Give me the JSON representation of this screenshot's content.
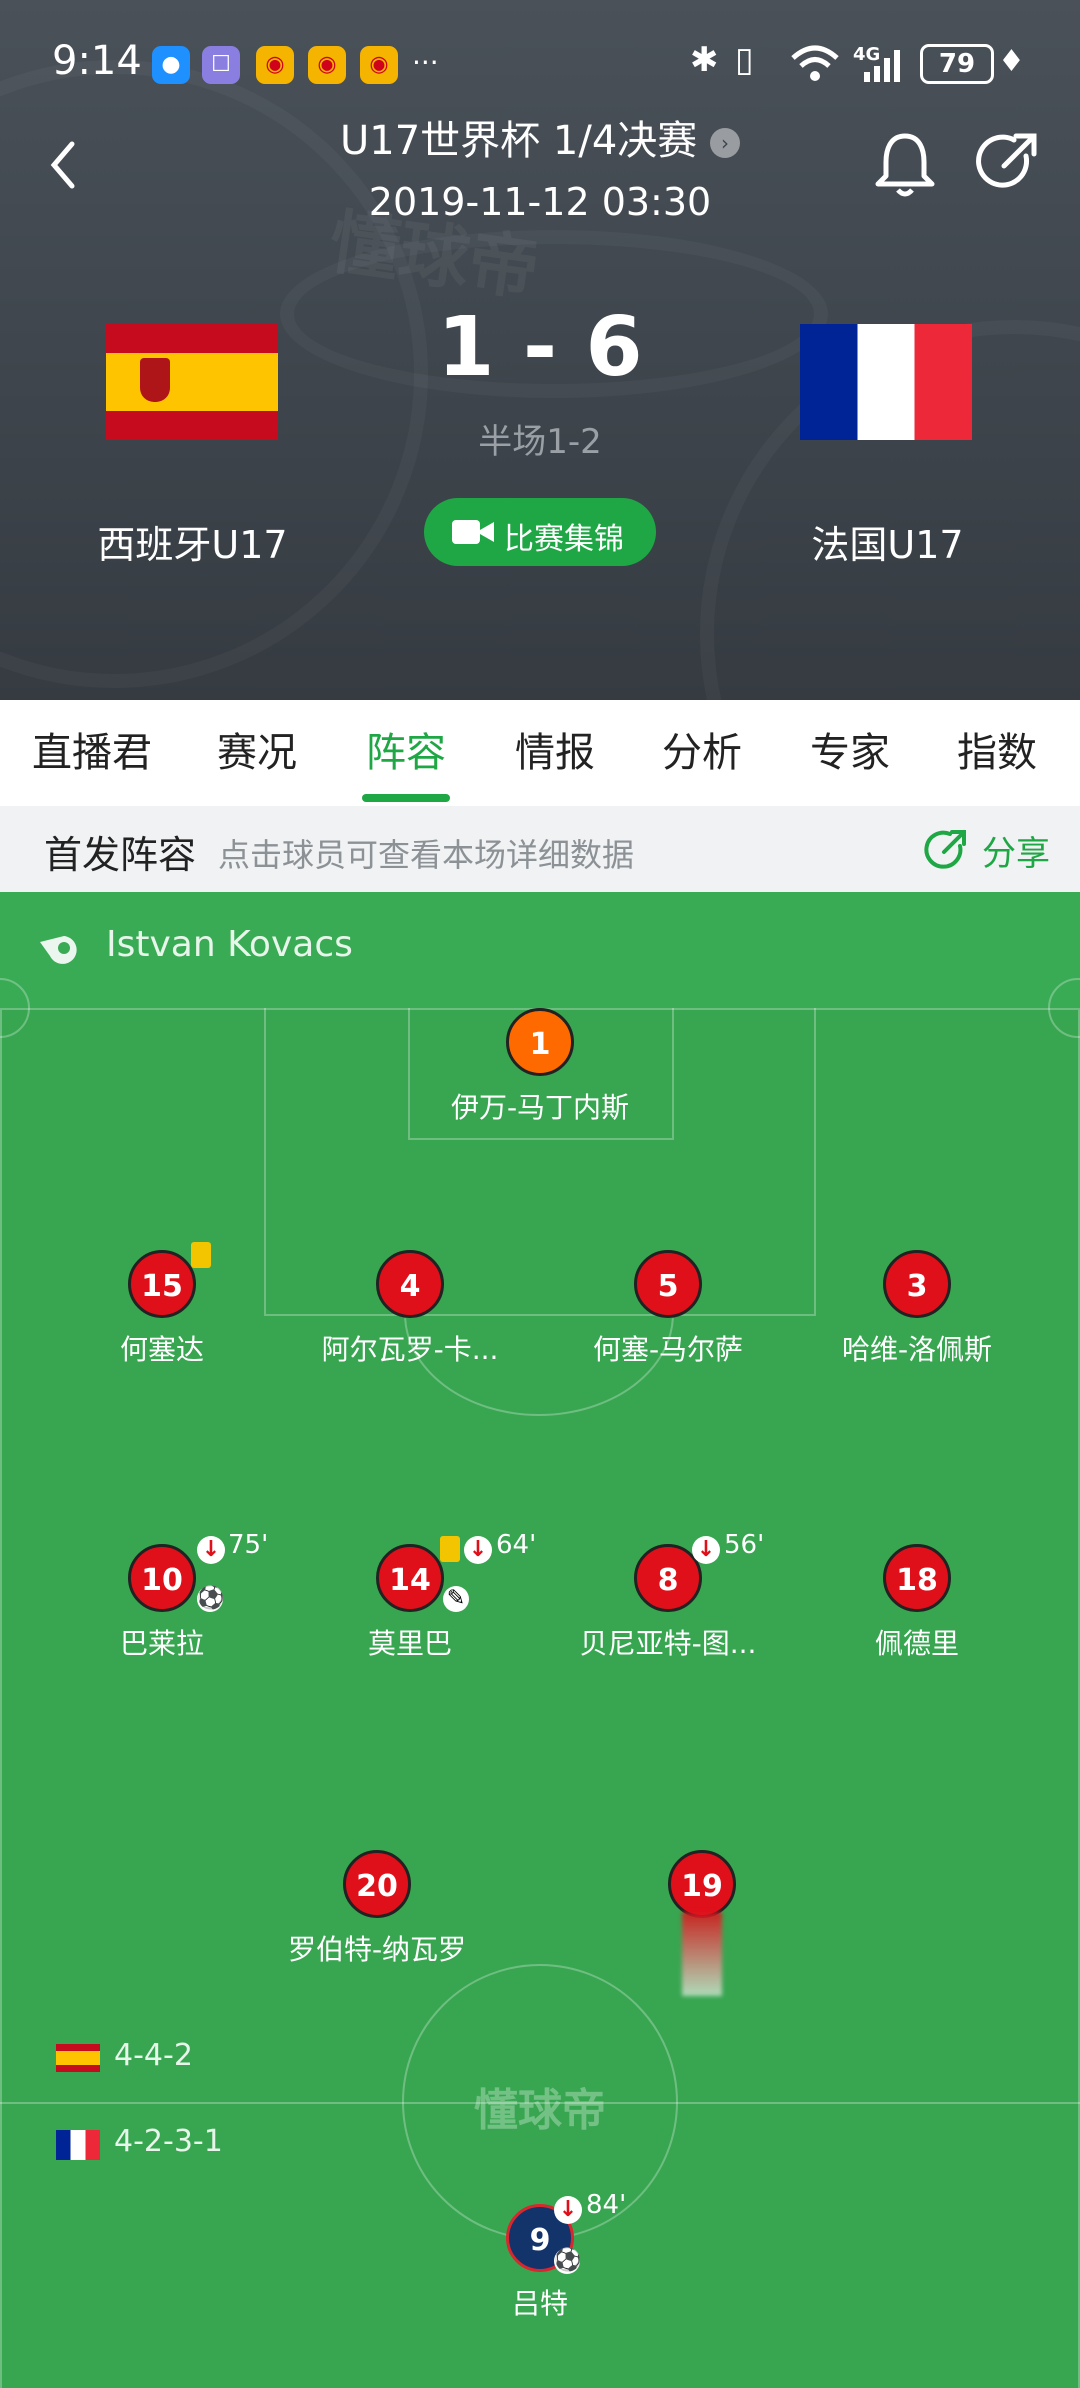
{
  "status_bar": {
    "time": "9:14",
    "more": "···",
    "battery": "79",
    "network": "4G"
  },
  "header": {
    "title": "U17世界杯 1/4决赛",
    "datetime": "2019-11-12 03:30",
    "watermark": "懂球帝"
  },
  "match": {
    "home": {
      "name": "西班牙U17"
    },
    "away": {
      "name": "法国U17"
    },
    "score": "1 - 6",
    "halftime": "半场1-2",
    "highlights_label": "比赛集锦"
  },
  "tabs": [
    "直播君",
    "赛况",
    "阵容",
    "情报",
    "分析",
    "专家",
    "指数"
  ],
  "active_tab": 2,
  "lineup_header": {
    "title": "首发阵容",
    "hint": "点击球员可查看本场详细数据",
    "share": "分享"
  },
  "referee": "Istvan Kovacs",
  "formations": {
    "home": "4-4-2",
    "away": "4-2-3-1"
  },
  "field_watermark": "懂球帝",
  "players": [
    {
      "number": "1",
      "name": "伊万-马丁内斯"
    },
    {
      "number": "15",
      "name": "何塞达"
    },
    {
      "number": "4",
      "name": "阿尔瓦罗-卡..."
    },
    {
      "number": "5",
      "name": "何塞-马尔萨"
    },
    {
      "number": "3",
      "name": "哈维-洛佩斯"
    },
    {
      "number": "10",
      "name": "巴莱拉",
      "sub_time": "75'"
    },
    {
      "number": "14",
      "name": "莫里巴",
      "sub_time": "64'"
    },
    {
      "number": "8",
      "name": "贝尼亚特-图...",
      "sub_time": "56'"
    },
    {
      "number": "18",
      "name": "佩德里"
    },
    {
      "number": "20",
      "name": "罗伯特-纳瓦罗"
    },
    {
      "number": "19",
      "name": ""
    },
    {
      "number": "9",
      "name": "吕特",
      "sub_time": "84'"
    }
  ],
  "colors": {
    "accent": "#1fa745",
    "home_player": "#e0101a",
    "keeper": "#ff6a00",
    "away_player": "#13336b",
    "field": "#38a651"
  }
}
